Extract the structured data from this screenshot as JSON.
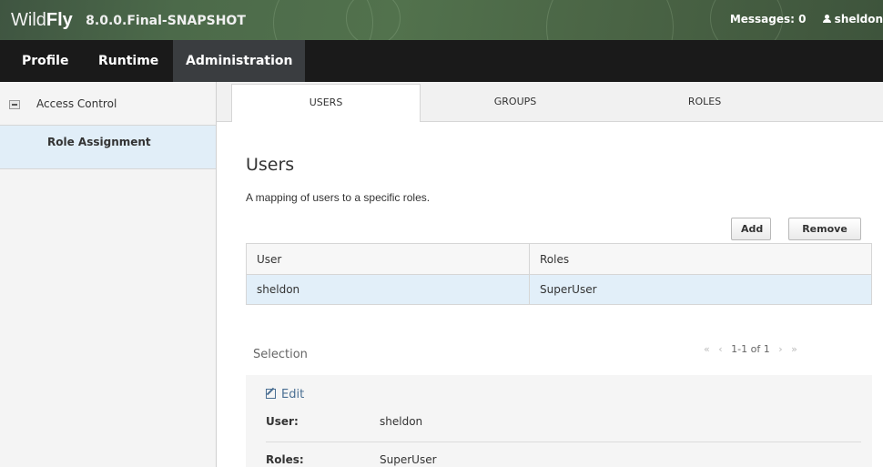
{
  "header": {
    "brand_wild": "Wild",
    "brand_fly": "Fly",
    "version": "8.0.0.Final-SNAPSHOT",
    "messages": "Messages: 0",
    "user": "sheldon"
  },
  "nav": {
    "items": [
      {
        "label": "Profile"
      },
      {
        "label": "Runtime"
      },
      {
        "label": "Administration"
      }
    ],
    "active": "Administration"
  },
  "sidebar": {
    "group_label": "Access Control",
    "items": [
      {
        "label": "Role Assignment"
      }
    ]
  },
  "tabs": [
    {
      "label": "USERS"
    },
    {
      "label": "GROUPS"
    },
    {
      "label": "ROLES"
    }
  ],
  "main": {
    "title": "Users",
    "description": "A mapping of users to a specific roles.",
    "add_label": "Add",
    "remove_label": "Remove",
    "table": {
      "columns": [
        "User",
        "Roles"
      ],
      "rows": [
        [
          "sheldon",
          "SuperUser"
        ]
      ]
    },
    "pager": {
      "first": "«",
      "prev": "‹",
      "label": "1-1 of 1",
      "next": "›",
      "last": "»"
    },
    "selection": {
      "title": "Selection",
      "edit_label": "Edit",
      "user_label": "User:",
      "user_value": "sheldon",
      "roles_label": "Roles:",
      "roles_value": "SuperUser"
    }
  },
  "colors": {
    "header_bg": "#4c6a4a",
    "nav_bg": "#1a1a1a",
    "active_nav": "#3a3d40",
    "selected_row": "#e2eff9",
    "link": "#4a6f93"
  }
}
